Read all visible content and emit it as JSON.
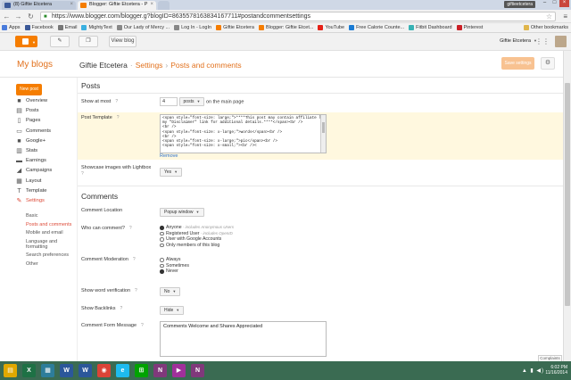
{
  "browser": {
    "tabs": [
      {
        "title": "(8) Giftie Etcetera",
        "active": false,
        "fav_color": "#3b5998"
      },
      {
        "title": "Blogger: Giftie Etcetera - P",
        "active": true,
        "fav_color": "#f57d00"
      },
      {
        "title": "",
        "active": false,
        "fav_color": "#bfcadb"
      }
    ],
    "profile_name": "giftieetcetera",
    "url": "https://www.blogger.com/blogger.g?blogID=8635578163834167711#postandcommentsettings",
    "bookmarks": [
      {
        "label": "Apps",
        "color": "#4a7cdc"
      },
      {
        "label": "Facebook",
        "color": "#3b5998"
      },
      {
        "label": "Email",
        "color": "#777777"
      },
      {
        "label": "MightyText",
        "color": "#3bb0e0"
      },
      {
        "label": "Our Lady of Mercy ...",
        "color": "#888888"
      },
      {
        "label": "Log In - LogIn",
        "color": "#888888"
      },
      {
        "label": "Giftie Etcetera",
        "color": "#f57d00"
      },
      {
        "label": "Blogger: Giftie Etcet...",
        "color": "#f57d00"
      },
      {
        "label": "YouTube",
        "color": "#e62117"
      },
      {
        "label": "Free Calorie Counte...",
        "color": "#1a7bd4"
      },
      {
        "label": "Fitbit Dashboard",
        "color": "#37b2b4"
      },
      {
        "label": "Pinterest",
        "color": "#cb2027"
      }
    ],
    "other_bookmarks": "Other bookmarks"
  },
  "topbar": {
    "view_blog": "View blog",
    "user_name": "Giftie Etcetera"
  },
  "header": {
    "my_blogs": "My blogs",
    "blog_name": "Giftie Etcetera",
    "crumb1": "Settings",
    "crumb2": "Posts and comments",
    "save_settings": "Save settings"
  },
  "sidebar": {
    "new_post": "New post",
    "items": [
      {
        "label": "Overview",
        "icon": "overview-icon",
        "glyph": "■"
      },
      {
        "label": "Posts",
        "icon": "posts-icon",
        "glyph": "▤"
      },
      {
        "label": "Pages",
        "icon": "pages-icon",
        "glyph": "▯"
      },
      {
        "label": "Comments",
        "icon": "comments-icon",
        "glyph": "▭"
      },
      {
        "label": "Google+",
        "icon": "google-plus-icon",
        "glyph": "■"
      },
      {
        "label": "Stats",
        "icon": "stats-icon",
        "glyph": "▥"
      },
      {
        "label": "Earnings",
        "icon": "earnings-icon",
        "glyph": "▬"
      },
      {
        "label": "Campaigns",
        "icon": "campaigns-icon",
        "glyph": "◢"
      },
      {
        "label": "Layout",
        "icon": "layout-icon",
        "glyph": "▦"
      },
      {
        "label": "Template",
        "icon": "template-icon",
        "glyph": "T"
      },
      {
        "label": "Settings",
        "icon": "wrench-icon",
        "glyph": "✎",
        "active": true
      }
    ],
    "sub_items": [
      {
        "label": "Basic",
        "active": false
      },
      {
        "label": "Posts and comments",
        "active": true
      },
      {
        "label": "Mobile and email",
        "active": false
      },
      {
        "label": "Language and formatting",
        "active": false
      },
      {
        "label": "Search preferences",
        "active": false
      },
      {
        "label": "Other",
        "active": false
      }
    ]
  },
  "posts": {
    "section_title": "Posts",
    "show_at_most_label": "Show at most",
    "show_at_most_value": "4",
    "show_at_most_unit": "posts",
    "show_at_most_suffix": "on the main page",
    "post_template_label": "Post Template",
    "post_template_lines": [
      "<span style=\"font-size: large;\">****This post may contain affiliate links. See",
      "my \"Disclaimer\" link for additional details.****</span><br />",
      "<br />",
      "<span style=\"font-size: x-large;\">words</span><br />",
      "<br />",
      "<span style=\"font-size: x-large;\">pic</span><br />",
      "<span style=\"font-size: x-small;\"><br /><"
    ],
    "remove": "Remove",
    "lightbox_label": "Showcase images with Lightbox",
    "lightbox_value": "Yes"
  },
  "comments": {
    "section_title": "Comments",
    "location_label": "Comment Location",
    "location_value": "Popup window",
    "who_label": "Who can comment?",
    "who_options": [
      {
        "label": "Anyone",
        "note": " - includes Anonymous Users",
        "checked": true
      },
      {
        "label": "Registered User",
        "note": " - includes OpenID",
        "checked": false
      },
      {
        "label": "User with Google Accounts",
        "note": "",
        "checked": false
      },
      {
        "label": "Only members of this blog",
        "note": "",
        "checked": false
      }
    ],
    "moderation_label": "Comment Moderation",
    "moderation_options": [
      {
        "label": "Always",
        "checked": false
      },
      {
        "label": "Sometimes",
        "checked": false
      },
      {
        "label": "Never",
        "checked": true
      }
    ],
    "word_verification_label": "Show word verification",
    "word_verification_value": "No",
    "backlinks_label": "Show Backlinks",
    "backlinks_value": "Hide",
    "form_message_label": "Comment Form Message",
    "form_message_value": "Comments Welcome and Shares Appreciated"
  },
  "complaints": "Complaints",
  "taskbar": {
    "apps": [
      {
        "name": "file-explorer-icon",
        "glyph": "▤",
        "color": "#e0a800"
      },
      {
        "name": "excel-icon",
        "glyph": "X",
        "color": "#1e7145"
      },
      {
        "name": "store-icon",
        "glyph": "▦",
        "color": "#2d7d9a"
      },
      {
        "name": "word-icon",
        "glyph": "W",
        "color": "#2b579a"
      },
      {
        "name": "word-icon-2",
        "glyph": "W",
        "color": "#2b579a"
      },
      {
        "name": "chrome-icon",
        "glyph": "◉",
        "color": "#db4437"
      },
      {
        "name": "internet-explorer-icon",
        "glyph": "e",
        "color": "#1ebbee"
      },
      {
        "name": "windows-store-icon",
        "glyph": "⊞",
        "color": "#00a300"
      },
      {
        "name": "onenote-icon",
        "glyph": "N",
        "color": "#80397b"
      },
      {
        "name": "media-player-icon",
        "glyph": "▶",
        "color": "#a0309a"
      },
      {
        "name": "onenote-icon-2",
        "glyph": "N",
        "color": "#80397b"
      }
    ],
    "time": "6:02 PM",
    "date": "11/16/2014"
  },
  "colors": {
    "blogger_orange": "#f57d00",
    "link_blue": "#2b6fcb",
    "active_red": "#dd4b39",
    "taskbar_green": "#3a6b52"
  }
}
